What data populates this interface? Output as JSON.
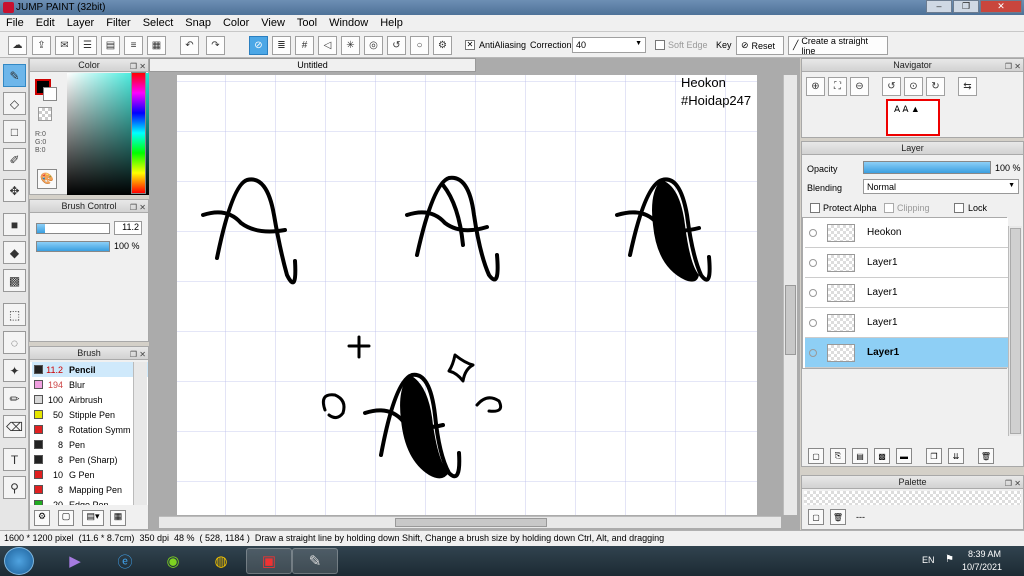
{
  "window": {
    "title": "JUMP PAINT (32bit)",
    "controls": [
      "–",
      "❐",
      "✕"
    ]
  },
  "menu": [
    "File",
    "Edit",
    "Layer",
    "Filter",
    "Select",
    "Snap",
    "Color",
    "View",
    "Tool",
    "Window",
    "Help"
  ],
  "toolbar": {
    "antialiasing_label": "AntiAliasing",
    "correction_label": "Correction",
    "correction_value": "40",
    "soft_edge_label": "Soft Edge",
    "key_label": "Key",
    "reset_label": "Reset",
    "straight_line_label": "Create a straight line"
  },
  "color_panel": {
    "title": "Color",
    "r": "R:0",
    "g": "G:0",
    "b": "B:0",
    "fg": "#000000",
    "bg": "#ffffff"
  },
  "brush_control": {
    "title": "Brush Control",
    "size": "11.2",
    "opacity": "100 %",
    "size_fill": 0.11,
    "opacity_fill": 1.0
  },
  "brush_panel": {
    "title": "Brush",
    "items": [
      {
        "size": "11.2",
        "name": "Pencil",
        "color": "#222222",
        "selected": true
      },
      {
        "size": "194",
        "name": "Blur",
        "color": "#f0a0e0"
      },
      {
        "size": "100",
        "name": "Airbrush",
        "color": "#d8d8d8"
      },
      {
        "size": "50",
        "name": "Stipple Pen",
        "color": "#e6e600"
      },
      {
        "size": "8",
        "name": "Rotation Symm",
        "color": "#e02020"
      },
      {
        "size": "8",
        "name": "Pen",
        "color": "#222222"
      },
      {
        "size": "8",
        "name": "Pen (Sharp)",
        "color": "#222222"
      },
      {
        "size": "10",
        "name": "G Pen",
        "color": "#e02020"
      },
      {
        "size": "8",
        "name": "Mapping Pen",
        "color": "#e02020"
      },
      {
        "size": "20",
        "name": "Edge Pen",
        "color": "#22aa22"
      }
    ]
  },
  "document": {
    "tab": "Untitled",
    "watermark_line1": "Heokon",
    "watermark_line2": "#Hoidap247"
  },
  "navigator": {
    "title": "Navigator"
  },
  "layer_panel": {
    "title": "Layer",
    "opacity_label": "Opacity",
    "opacity_value": "100 %",
    "blending_label": "Blending",
    "blending_value": "Normal",
    "protect_alpha": "Protect Alpha",
    "clipping": "Clipping",
    "lock": "Lock",
    "layers": [
      {
        "name": "Heokon",
        "selected": false
      },
      {
        "name": "Layer1",
        "selected": false
      },
      {
        "name": "Layer1",
        "selected": false
      },
      {
        "name": "Layer1",
        "selected": false
      },
      {
        "name": "Layer1",
        "selected": true
      }
    ]
  },
  "palette_panel": {
    "title": "Palette",
    "value": "---"
  },
  "status_bar": {
    "size": "1600 * 1200 pixel",
    "physical": "(11.6 * 8.7cm)",
    "dpi": "350 dpi",
    "zoom": "48 %",
    "cursor": "( 528, 1184 )",
    "hint": "Draw a straight line by holding down Shift, Change a brush size by holding down Ctrl, Alt, and dragging"
  },
  "taskbar": {
    "language": "EN",
    "time": "8:39 AM",
    "date": "10/7/2021"
  }
}
